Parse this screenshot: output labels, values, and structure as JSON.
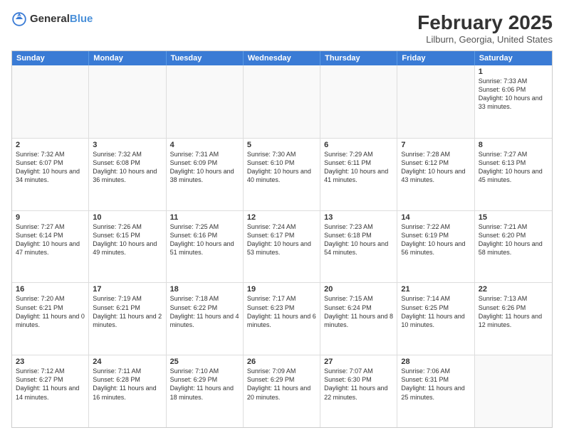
{
  "header": {
    "logo_general": "General",
    "logo_blue": "Blue",
    "title": "February 2025",
    "location": "Lilburn, Georgia, United States"
  },
  "weekdays": [
    "Sunday",
    "Monday",
    "Tuesday",
    "Wednesday",
    "Thursday",
    "Friday",
    "Saturday"
  ],
  "rows": [
    [
      {
        "day": "",
        "info": ""
      },
      {
        "day": "",
        "info": ""
      },
      {
        "day": "",
        "info": ""
      },
      {
        "day": "",
        "info": ""
      },
      {
        "day": "",
        "info": ""
      },
      {
        "day": "",
        "info": ""
      },
      {
        "day": "1",
        "info": "Sunrise: 7:33 AM\nSunset: 6:06 PM\nDaylight: 10 hours and 33 minutes."
      }
    ],
    [
      {
        "day": "2",
        "info": "Sunrise: 7:32 AM\nSunset: 6:07 PM\nDaylight: 10 hours and 34 minutes."
      },
      {
        "day": "3",
        "info": "Sunrise: 7:32 AM\nSunset: 6:08 PM\nDaylight: 10 hours and 36 minutes."
      },
      {
        "day": "4",
        "info": "Sunrise: 7:31 AM\nSunset: 6:09 PM\nDaylight: 10 hours and 38 minutes."
      },
      {
        "day": "5",
        "info": "Sunrise: 7:30 AM\nSunset: 6:10 PM\nDaylight: 10 hours and 40 minutes."
      },
      {
        "day": "6",
        "info": "Sunrise: 7:29 AM\nSunset: 6:11 PM\nDaylight: 10 hours and 41 minutes."
      },
      {
        "day": "7",
        "info": "Sunrise: 7:28 AM\nSunset: 6:12 PM\nDaylight: 10 hours and 43 minutes."
      },
      {
        "day": "8",
        "info": "Sunrise: 7:27 AM\nSunset: 6:13 PM\nDaylight: 10 hours and 45 minutes."
      }
    ],
    [
      {
        "day": "9",
        "info": "Sunrise: 7:27 AM\nSunset: 6:14 PM\nDaylight: 10 hours and 47 minutes."
      },
      {
        "day": "10",
        "info": "Sunrise: 7:26 AM\nSunset: 6:15 PM\nDaylight: 10 hours and 49 minutes."
      },
      {
        "day": "11",
        "info": "Sunrise: 7:25 AM\nSunset: 6:16 PM\nDaylight: 10 hours and 51 minutes."
      },
      {
        "day": "12",
        "info": "Sunrise: 7:24 AM\nSunset: 6:17 PM\nDaylight: 10 hours and 53 minutes."
      },
      {
        "day": "13",
        "info": "Sunrise: 7:23 AM\nSunset: 6:18 PM\nDaylight: 10 hours and 54 minutes."
      },
      {
        "day": "14",
        "info": "Sunrise: 7:22 AM\nSunset: 6:19 PM\nDaylight: 10 hours and 56 minutes."
      },
      {
        "day": "15",
        "info": "Sunrise: 7:21 AM\nSunset: 6:20 PM\nDaylight: 10 hours and 58 minutes."
      }
    ],
    [
      {
        "day": "16",
        "info": "Sunrise: 7:20 AM\nSunset: 6:21 PM\nDaylight: 11 hours and 0 minutes."
      },
      {
        "day": "17",
        "info": "Sunrise: 7:19 AM\nSunset: 6:21 PM\nDaylight: 11 hours and 2 minutes."
      },
      {
        "day": "18",
        "info": "Sunrise: 7:18 AM\nSunset: 6:22 PM\nDaylight: 11 hours and 4 minutes."
      },
      {
        "day": "19",
        "info": "Sunrise: 7:17 AM\nSunset: 6:23 PM\nDaylight: 11 hours and 6 minutes."
      },
      {
        "day": "20",
        "info": "Sunrise: 7:15 AM\nSunset: 6:24 PM\nDaylight: 11 hours and 8 minutes."
      },
      {
        "day": "21",
        "info": "Sunrise: 7:14 AM\nSunset: 6:25 PM\nDaylight: 11 hours and 10 minutes."
      },
      {
        "day": "22",
        "info": "Sunrise: 7:13 AM\nSunset: 6:26 PM\nDaylight: 11 hours and 12 minutes."
      }
    ],
    [
      {
        "day": "23",
        "info": "Sunrise: 7:12 AM\nSunset: 6:27 PM\nDaylight: 11 hours and 14 minutes."
      },
      {
        "day": "24",
        "info": "Sunrise: 7:11 AM\nSunset: 6:28 PM\nDaylight: 11 hours and 16 minutes."
      },
      {
        "day": "25",
        "info": "Sunrise: 7:10 AM\nSunset: 6:29 PM\nDaylight: 11 hours and 18 minutes."
      },
      {
        "day": "26",
        "info": "Sunrise: 7:09 AM\nSunset: 6:29 PM\nDaylight: 11 hours and 20 minutes."
      },
      {
        "day": "27",
        "info": "Sunrise: 7:07 AM\nSunset: 6:30 PM\nDaylight: 11 hours and 22 minutes."
      },
      {
        "day": "28",
        "info": "Sunrise: 7:06 AM\nSunset: 6:31 PM\nDaylight: 11 hours and 25 minutes."
      },
      {
        "day": "",
        "info": ""
      }
    ]
  ]
}
